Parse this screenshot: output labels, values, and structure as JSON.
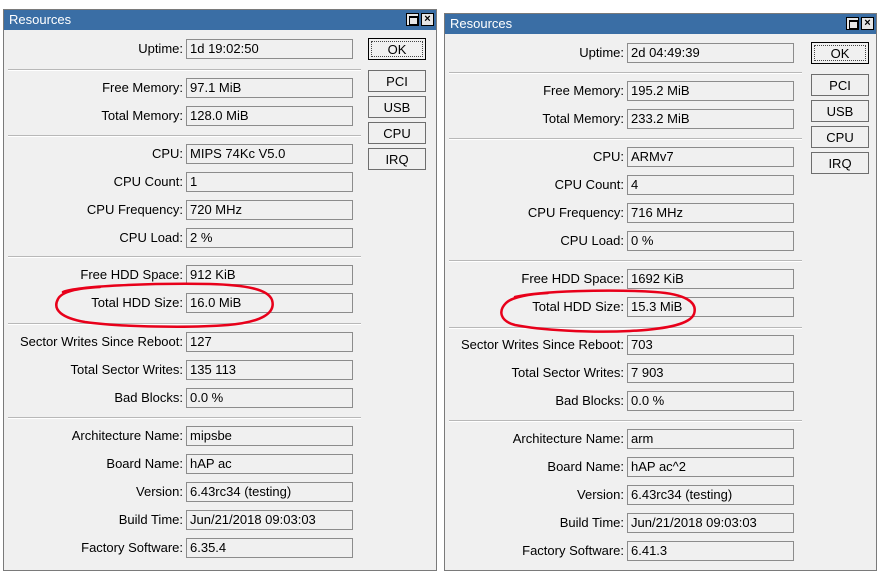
{
  "colors": {
    "titlebar": "#3a6ea5",
    "annotation": "#e8001a"
  },
  "left": {
    "title": "Resources",
    "buttons": {
      "ok": "OK",
      "pci": "PCI",
      "usb": "USB",
      "cpu": "CPU",
      "irq": "IRQ"
    },
    "fields": {
      "uptime": {
        "label": "Uptime:",
        "value": "1d 19:02:50"
      },
      "free_memory": {
        "label": "Free Memory:",
        "value": "97.1 MiB"
      },
      "total_memory": {
        "label": "Total Memory:",
        "value": "128.0 MiB"
      },
      "cpu": {
        "label": "CPU:",
        "value": "MIPS 74Kc V5.0"
      },
      "cpu_count": {
        "label": "CPU Count:",
        "value": "1"
      },
      "cpu_frequency": {
        "label": "CPU Frequency:",
        "value": "720 MHz"
      },
      "cpu_load": {
        "label": "CPU Load:",
        "value": "2 %"
      },
      "free_hdd": {
        "label": "Free HDD Space:",
        "value": "912 KiB"
      },
      "total_hdd": {
        "label": "Total HDD Size:",
        "value": "16.0 MiB"
      },
      "sector_writes_reboot": {
        "label": "Sector Writes Since Reboot:",
        "value": "127"
      },
      "total_sector_writes": {
        "label": "Total Sector Writes:",
        "value": "135 113"
      },
      "bad_blocks": {
        "label": "Bad Blocks:",
        "value": "0.0 %"
      },
      "architecture": {
        "label": "Architecture Name:",
        "value": "mipsbe"
      },
      "board": {
        "label": "Board Name:",
        "value": "hAP ac"
      },
      "version": {
        "label": "Version:",
        "value": "6.43rc34 (testing)"
      },
      "build_time": {
        "label": "Build Time:",
        "value": "Jun/21/2018 09:03:03"
      },
      "factory_software": {
        "label": "Factory Software:",
        "value": "6.35.4"
      }
    }
  },
  "right": {
    "title": "Resources",
    "buttons": {
      "ok": "OK",
      "pci": "PCI",
      "usb": "USB",
      "cpu": "CPU",
      "irq": "IRQ"
    },
    "fields": {
      "uptime": {
        "label": "Uptime:",
        "value": "2d 04:49:39"
      },
      "free_memory": {
        "label": "Free Memory:",
        "value": "195.2 MiB"
      },
      "total_memory": {
        "label": "Total Memory:",
        "value": "233.2 MiB"
      },
      "cpu": {
        "label": "CPU:",
        "value": "ARMv7"
      },
      "cpu_count": {
        "label": "CPU Count:",
        "value": "4"
      },
      "cpu_frequency": {
        "label": "CPU Frequency:",
        "value": "716 MHz"
      },
      "cpu_load": {
        "label": "CPU Load:",
        "value": "0 %"
      },
      "free_hdd": {
        "label": "Free HDD Space:",
        "value": "1692 KiB"
      },
      "total_hdd": {
        "label": "Total HDD Size:",
        "value": "15.3 MiB"
      },
      "sector_writes_reboot": {
        "label": "Sector Writes Since Reboot:",
        "value": "703"
      },
      "total_sector_writes": {
        "label": "Total Sector Writes:",
        "value": "7 903"
      },
      "bad_blocks": {
        "label": "Bad Blocks:",
        "value": "0.0 %"
      },
      "architecture": {
        "label": "Architecture Name:",
        "value": "arm"
      },
      "board": {
        "label": "Board Name:",
        "value": "hAP ac^2"
      },
      "version": {
        "label": "Version:",
        "value": "6.43rc34 (testing)"
      },
      "build_time": {
        "label": "Build Time:",
        "value": "Jun/21/2018 09:03:03"
      },
      "factory_software": {
        "label": "Factory Software:",
        "value": "6.41.3"
      }
    }
  }
}
